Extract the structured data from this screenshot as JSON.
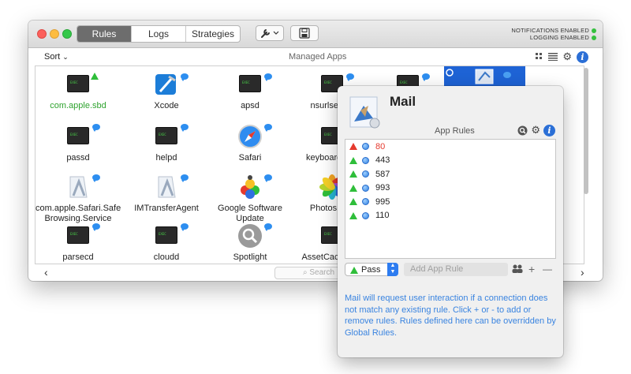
{
  "window": {
    "tabs": [
      "Rules",
      "Logs",
      "Strategies"
    ],
    "active_tab": "Rules",
    "status": [
      "NOTIFICATIONS ENABLED",
      "LOGGING ENABLED"
    ],
    "status_color": "#35c03e"
  },
  "toolbar": {
    "sort_label": "Sort",
    "section_title": "Managed Apps"
  },
  "apps": [
    {
      "label": "com.apple.sbd",
      "icon": "terminal-icon",
      "label_color": "#2fa32f",
      "badge": "green-triangle"
    },
    {
      "label": "Xcode",
      "icon": "xcode-icon",
      "badge": "chat-bubble"
    },
    {
      "label": "apsd",
      "icon": "terminal-icon",
      "badge": "chat-bubble"
    },
    {
      "label": "nsurlsessio",
      "icon": "terminal-icon",
      "badge": "chat-bubble"
    },
    {
      "label": "",
      "icon": "terminal-icon",
      "badge": "chat-bubble"
    },
    {
      "label": "passd",
      "icon": "terminal-icon",
      "badge": "chat-bubble"
    },
    {
      "label": "helpd",
      "icon": "terminal-icon",
      "badge": "chat-bubble"
    },
    {
      "label": "Safari",
      "icon": "safari-icon",
      "badge": "chat-bubble"
    },
    {
      "label": "keyboardserv",
      "icon": "terminal-icon",
      "badge": "chat-bubble"
    },
    {
      "label": "com.apple.Safari.Safe Browsing.Service",
      "icon": "app-generic-icon",
      "badge": "chat-bubble"
    },
    {
      "label": "IMTransferAgent",
      "icon": "app-generic-icon",
      "badge": "chat-bubble"
    },
    {
      "label": "Google Software Update",
      "icon": "google-update-icon",
      "badge": "chat-bubble"
    },
    {
      "label": "Photos Age",
      "icon": "photos-icon",
      "badge": "chat-bubble"
    },
    {
      "label": "parsecd",
      "icon": "terminal-icon",
      "badge": "chat-bubble"
    },
    {
      "label": "cloudd",
      "icon": "terminal-icon",
      "badge": "chat-bubble"
    },
    {
      "label": "Spotlight",
      "icon": "spotlight-icon",
      "badge": "chat-bubble"
    },
    {
      "label": "AssetCacheLoc",
      "icon": "terminal-icon",
      "badge": "chat-bubble"
    }
  ],
  "search_placeholder": "Search",
  "popover": {
    "app_name": "Mail",
    "section": "App Rules",
    "rules": [
      {
        "port": "80",
        "action": "block",
        "color": "#e53a2e"
      },
      {
        "port": "443",
        "action": "pass",
        "color": "#2fbe3a"
      },
      {
        "port": "587",
        "action": "pass",
        "color": "#2fbe3a"
      },
      {
        "port": "993",
        "action": "pass",
        "color": "#2fbe3a"
      },
      {
        "port": "995",
        "action": "pass",
        "color": "#2fbe3a"
      },
      {
        "port": "110",
        "action": "pass",
        "color": "#2fbe3a"
      }
    ],
    "action_select": "Pass",
    "add_rule_placeholder": "Add App Rule",
    "plus_label": "+",
    "minus_label": "—",
    "hint": "Mail will request user interaction if a connection does not match any existing rule. Click + or - to add or remove rules. Rules defined here can be overridden by Global Rules."
  }
}
